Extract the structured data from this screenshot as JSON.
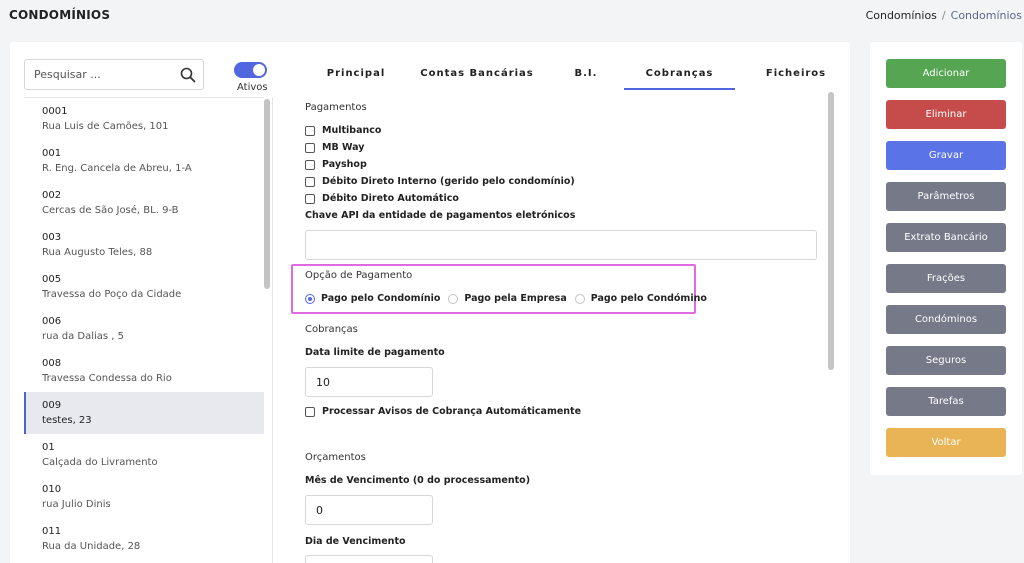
{
  "header": {
    "title": "CONDOMÍNIOS",
    "breadcrumb": [
      "Condomínios",
      "/",
      "Condomínios"
    ]
  },
  "sidebar": {
    "search_placeholder": "Pesquisar ...",
    "toggle_label": "Ativos",
    "toggle_on": true,
    "items": [
      {
        "code": "0001",
        "address": "Rua Luis de Camões, 101"
      },
      {
        "code": "001",
        "address": "R. Eng. Cancela de Abreu, 1-A"
      },
      {
        "code": "002",
        "address": "Cercas de São José, BL. 9-B"
      },
      {
        "code": "003",
        "address": "Rua Augusto Teles, 88"
      },
      {
        "code": "005",
        "address": "Travessa do Poço da Cidade"
      },
      {
        "code": "006",
        "address": "rua da Dalias , 5"
      },
      {
        "code": "008",
        "address": "Travessa Condessa do Rio"
      },
      {
        "code": "009",
        "address": "testes, 23"
      },
      {
        "code": "01",
        "address": "Calçada do Livramento"
      },
      {
        "code": "010",
        "address": "rua Julio Dinis"
      },
      {
        "code": "011",
        "address": "Rua da Unidade, 28"
      }
    ],
    "selected_index": 7
  },
  "tabs": [
    {
      "label": "Principal"
    },
    {
      "label": "Contas Bancárias"
    },
    {
      "label": "B.I."
    },
    {
      "label": "Cobranças",
      "active": true
    },
    {
      "label": "Ficheiros"
    }
  ],
  "form": {
    "pagamentos_title": "Pagamentos",
    "payment_methods": [
      {
        "label": "Multibanco",
        "checked": false
      },
      {
        "label": "MB Way",
        "checked": false
      },
      {
        "label": "Payshop",
        "checked": false
      },
      {
        "label": "Débito Direto Interno (gerido pelo condomínio)",
        "checked": false
      },
      {
        "label": "Débito Direto Automático",
        "checked": false
      }
    ],
    "api_key_label": "Chave API da entidade de pagamentos eletrónicos",
    "api_key_value": "",
    "payment_option_label": "Opção de Pagamento",
    "payment_options": [
      {
        "label": "Pago pelo Condomínio",
        "selected": true
      },
      {
        "label": "Pago pela Empresa",
        "selected": false
      },
      {
        "label": "Pago pelo Condómino",
        "selected": false
      }
    ],
    "cobrancas_title": "Cobranças",
    "due_date_label": "Data limite de pagamento",
    "due_date_value": "10",
    "auto_notice_label": "Processar Avisos de Cobrança Automáticamente",
    "auto_notice_checked": false,
    "orcamentos_title": "Orçamentos",
    "due_month_label": "Mês de Vencimento (0 do processamento)",
    "due_month_value": "0",
    "due_day_label": "Dia de Vencimento",
    "due_day_value": ""
  },
  "actions": [
    {
      "label": "Adicionar",
      "color": "#55a552"
    },
    {
      "label": "Eliminar",
      "color": "#c64b4b"
    },
    {
      "label": "Gravar",
      "color": "#5a73e6"
    },
    {
      "label": "Parâmetros",
      "color": "#757988"
    },
    {
      "label": "Extrato Bancário",
      "color": "#757988"
    },
    {
      "label": "Frações",
      "color": "#757988"
    },
    {
      "label": "Condóminos",
      "color": "#757988"
    },
    {
      "label": "Seguros",
      "color": "#757988"
    },
    {
      "label": "Tarefas",
      "color": "#757988"
    },
    {
      "label": "Voltar",
      "color": "#e8b455"
    }
  ],
  "colors": {
    "accent": "#5266e0",
    "highlight_border": "#e06be0",
    "background": "#f3f4f6"
  }
}
